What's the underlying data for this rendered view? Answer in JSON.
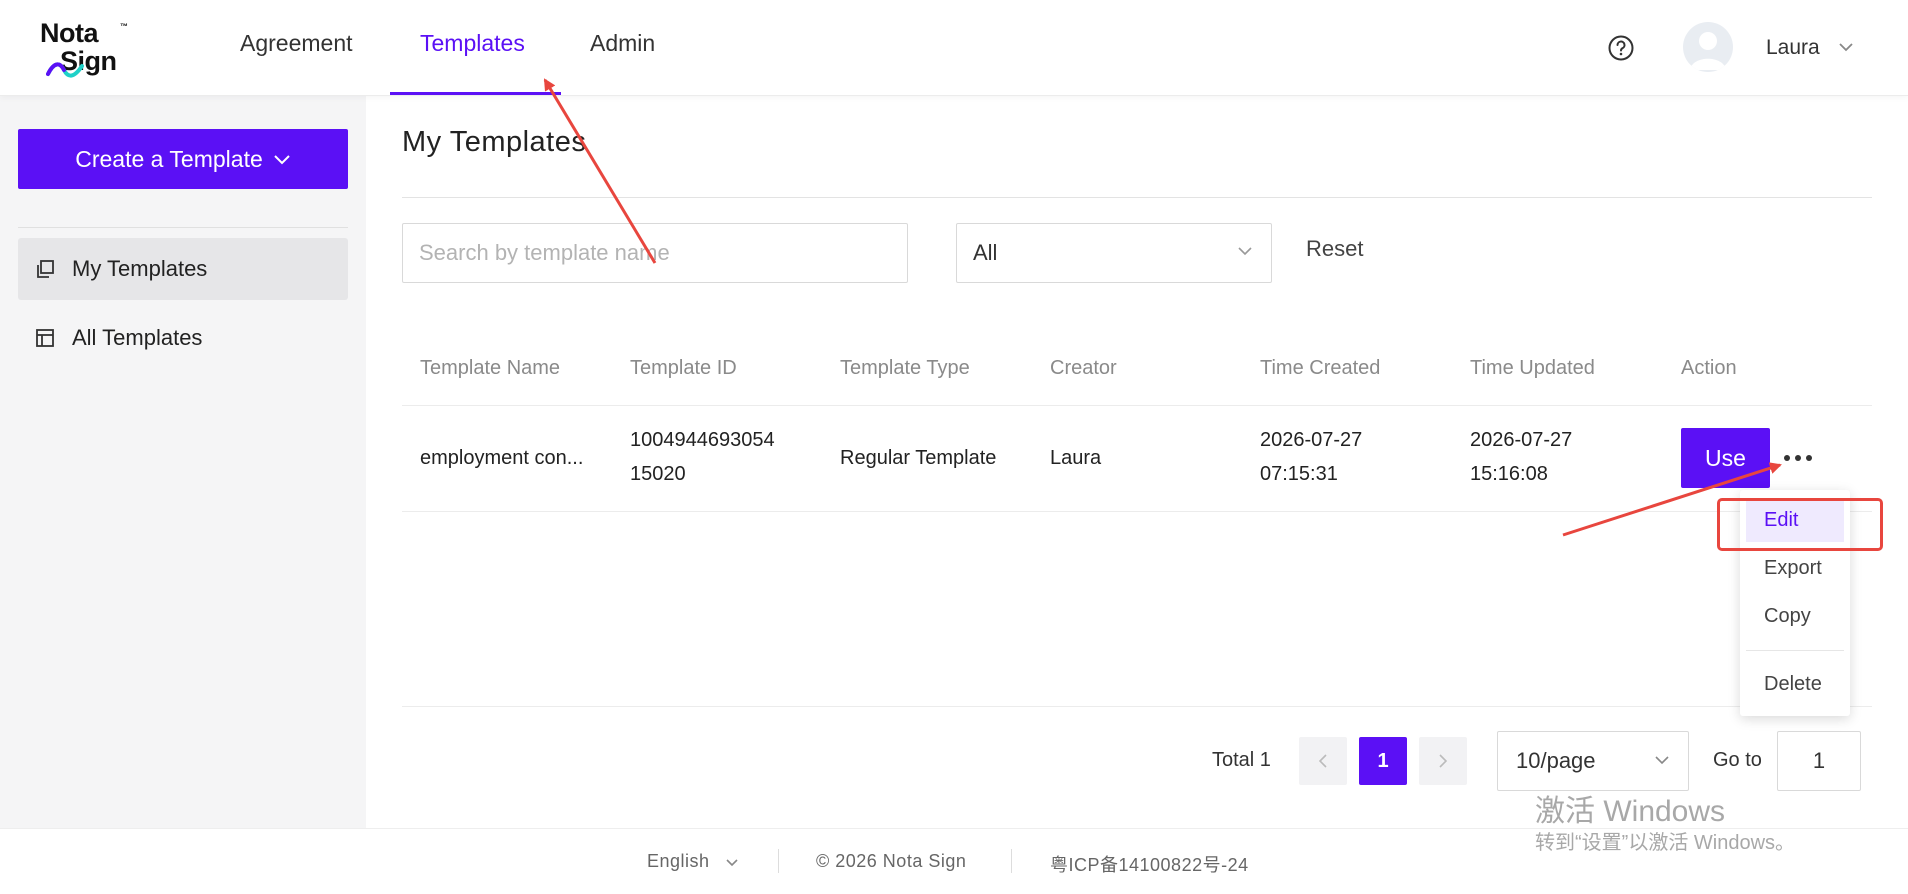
{
  "brand": {
    "logo_line1": "Nota",
    "logo_line2": "Sign",
    "logo_tm": "™"
  },
  "nav": {
    "items": [
      {
        "label": "Agreement"
      },
      {
        "label": "Templates"
      },
      {
        "label": "Admin"
      }
    ],
    "active": "Templates"
  },
  "user": {
    "name": "Laura"
  },
  "icons": {
    "help": "help-circle-icon",
    "avatar": "user-avatar-icon",
    "chevron": "chevron-down-icon",
    "my_templates": "copy-stack-icon",
    "all_templates": "layout-icon",
    "more": "more-horizontal-icon"
  },
  "colors": {
    "accent": "#5b10f5",
    "annotation": "#e8463e",
    "sidebar_bg": "#f5f5f6"
  },
  "sidebar": {
    "create_button": "Create a Template",
    "items": [
      {
        "label": "My Templates",
        "active": true
      },
      {
        "label": "All Templates",
        "active": false
      }
    ]
  },
  "main": {
    "title": "My Templates",
    "search_placeholder": "Search by template name",
    "type_filter": "All",
    "reset_label": "Reset",
    "table": {
      "columns": [
        "Template Name",
        "Template ID",
        "Template Type",
        "Creator",
        "Time Created",
        "Time Updated",
        "Action"
      ],
      "rows": [
        {
          "name": "employment con...",
          "id_line1": "1004944693054",
          "id_line2": "15020",
          "type": "Regular Template",
          "creator": "Laura",
          "created_date": "2026-07-27",
          "created_time": "07:15:31",
          "updated_date": "2026-07-27",
          "updated_time": "15:16:08",
          "use_label": "Use"
        }
      ]
    },
    "action_menu": [
      "Edit",
      "Export",
      "Copy",
      "Delete"
    ],
    "pagination": {
      "total": "Total 1",
      "current_page": "1",
      "page_size": "10/page",
      "goto_label": "Go to",
      "goto_value": "1"
    }
  },
  "footer": {
    "language": "English",
    "copyright": "© 2026 Nota Sign",
    "icp": "粤ICP备14100822号-24"
  },
  "watermark": {
    "line1": "激活 Windows",
    "line2": "转到“设置”以激活 Windows。"
  }
}
